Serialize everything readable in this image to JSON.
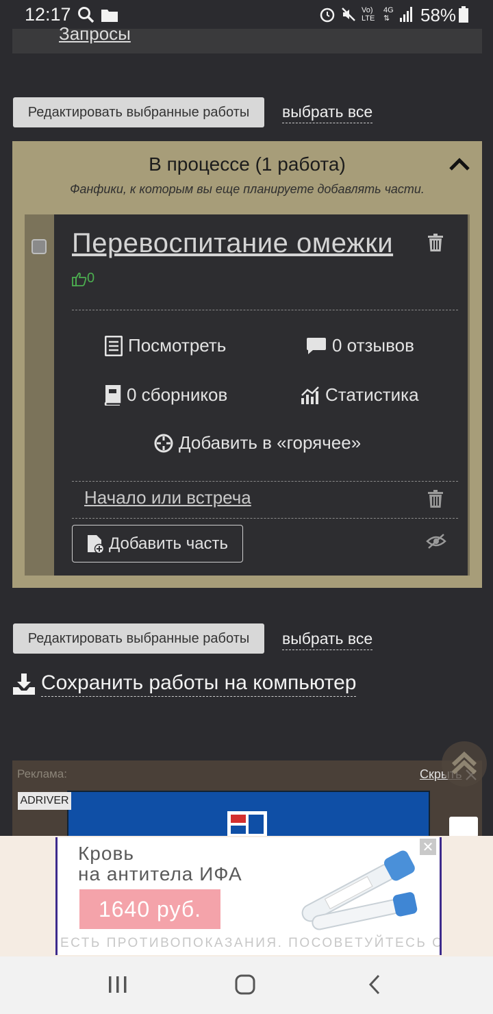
{
  "status_bar": {
    "time": "12:17",
    "battery": "58%",
    "icons": [
      "search-icon",
      "folder-icon",
      "alarm-icon",
      "mute-icon",
      "volte-icon",
      "4g-icon",
      "signal-icon",
      "battery-icon"
    ]
  },
  "top_card": {
    "link": "Запросы"
  },
  "bulk_top": {
    "edit_button": "Редактировать выбранные работы",
    "select_all": "выбрать все"
  },
  "section": {
    "title": "В процессе (1 работа)",
    "subtitle": "Фанфики, к которым вы еще планируете добавлять части."
  },
  "work": {
    "title": "Перевоспитание омежки",
    "likes": "0",
    "actions": {
      "view": "Посмотреть",
      "reviews": "0 отзывов",
      "collections": "0 сборников",
      "stats": "Статистика",
      "hot": "Добавить в «горячее»"
    },
    "chapter": "Начало или встреча",
    "add_chapter": "Добавить часть"
  },
  "bulk_bottom": {
    "edit_button": "Редактировать выбранные работы",
    "select_all": "выбрать все"
  },
  "save_works": "Сохранить работы на компьютер",
  "ad": {
    "label": "Реклама:",
    "hide": "Скрыть",
    "badge": "ADRIVER"
  },
  "banner": {
    "line1": "Кровь",
    "line2": "на антитела ИФА",
    "price": "1640 руб.",
    "disclaimer": "ЕСТЬ ПРОТИВОПОКАЗАНИЯ. ПОСОВЕТУЙТЕСЬ С ВРАЧОМ",
    "close": "✕"
  },
  "colors": {
    "section_bg": "#a79d79",
    "card_bg": "#2d2d30",
    "like_green": "#4caf50"
  }
}
